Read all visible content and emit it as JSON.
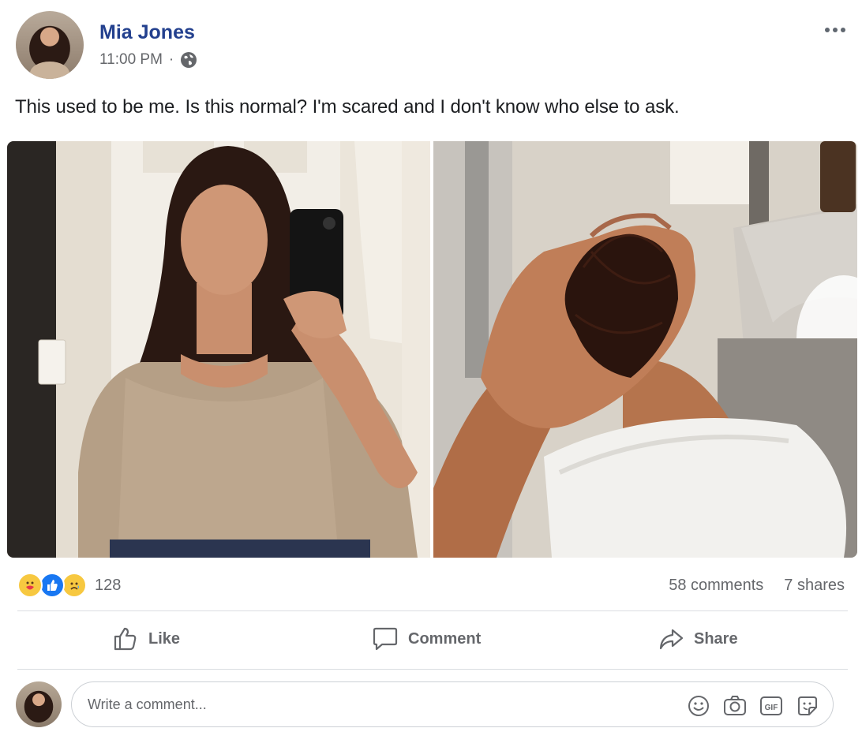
{
  "post": {
    "author": "Mia Jones",
    "time": "11:00 PM",
    "separator": "·",
    "privacy_icon": "globe-icon",
    "text": "This used to be me. Is this normal? I'm scared and I don't know who else to ask.",
    "photos": [
      {
        "subject": "mirror-selfie"
      },
      {
        "subject": "hand-holding-hair"
      }
    ]
  },
  "stats": {
    "reaction_icons": [
      "care-icon",
      "like-icon",
      "sad-icon"
    ],
    "reaction_count": "128",
    "comments": "58 comments",
    "shares": "7 shares"
  },
  "actions": {
    "like": "Like",
    "comment": "Comment",
    "share": "Share"
  },
  "composer": {
    "placeholder": "Write a comment...",
    "icons": [
      "emoji-icon",
      "camera-icon",
      "gif-icon",
      "sticker-icon"
    ],
    "gif_label": "GIF"
  },
  "colors": {
    "author_name": "#23408e",
    "meta_text": "#65676b",
    "like_blue": "#1877f2",
    "reaction_yellow": "#f7c840"
  }
}
